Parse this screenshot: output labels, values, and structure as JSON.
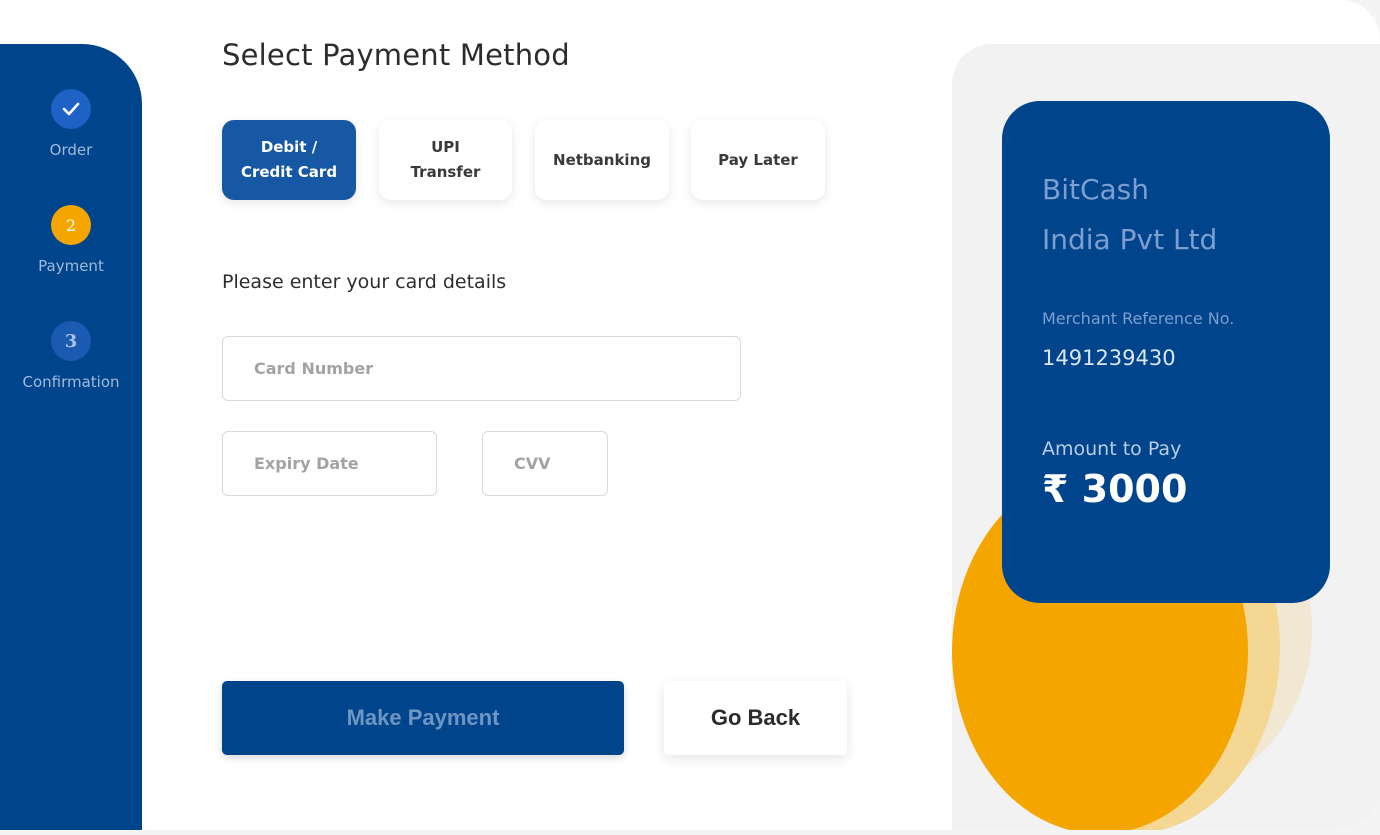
{
  "stepper": {
    "steps": [
      {
        "label": "Order",
        "marker": "✓",
        "state": "completed"
      },
      {
        "label": "Payment",
        "marker": "2",
        "state": "current"
      },
      {
        "label": "Confirmation",
        "marker": "3",
        "state": "upcoming"
      }
    ]
  },
  "main": {
    "title": "Select Payment Method",
    "tabs": [
      {
        "line1": "Debit /",
        "line2": "Credit Card",
        "active": true
      },
      {
        "line1": "UPI",
        "line2": "Transfer",
        "active": false
      },
      {
        "line1": "Netbanking",
        "line2": "",
        "active": false
      },
      {
        "line1": "Pay Later",
        "line2": "",
        "active": false
      }
    ],
    "instructions": "Please enter your card details",
    "fields": {
      "card_number": {
        "placeholder": "Card Number",
        "value": ""
      },
      "expiry": {
        "placeholder": "Expiry Date",
        "value": ""
      },
      "cvv": {
        "placeholder": "CVV",
        "value": ""
      }
    },
    "make_payment_label": "Make Payment",
    "go_back_label": "Go Back"
  },
  "merchant": {
    "name_line1": "BitCash",
    "name_line2": "India Pvt Ltd",
    "ref_label": "Merchant Reference No.",
    "ref_value": "1491239430",
    "amount_label": "Amount to Pay",
    "amount_value": "₹ 3000"
  },
  "colors": {
    "brand_blue": "#00458b",
    "active_tab": "#1758a4",
    "accent_orange": "#f5a500"
  },
  "icons": {
    "completed_step": "check-icon"
  }
}
